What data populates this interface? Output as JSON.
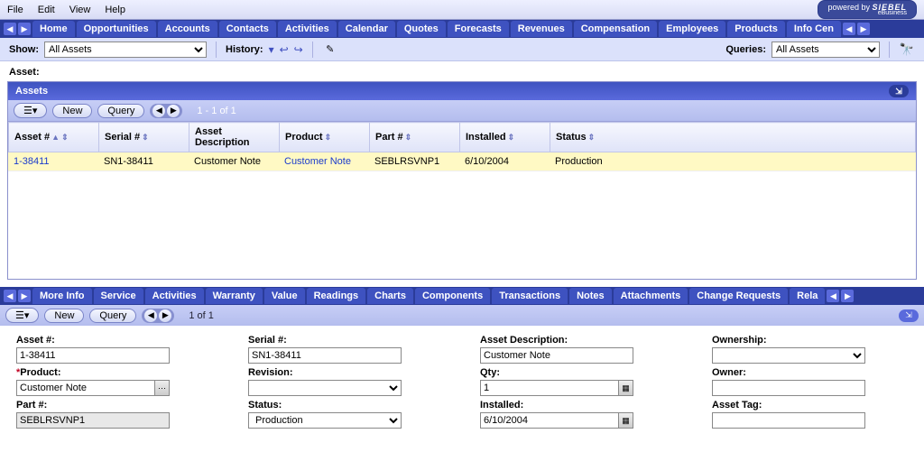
{
  "menu": {
    "file": "File",
    "edit": "Edit",
    "view": "View",
    "help": "Help"
  },
  "brand": {
    "powered": "powered by",
    "name": "SIEBEL",
    "sub": "eBusiness"
  },
  "main_tabs": [
    "Home",
    "Opportunities",
    "Accounts",
    "Contacts",
    "Activities",
    "Calendar",
    "Quotes",
    "Forecasts",
    "Revenues",
    "Compensation",
    "Employees",
    "Products",
    "Info Cen"
  ],
  "showbar": {
    "show_label": "Show:",
    "show_value": "All Assets",
    "history_label": "History:",
    "queries_label": "Queries:",
    "queries_value": "All Assets"
  },
  "asset_header": "Asset:",
  "assets_panel": {
    "title": "Assets",
    "buttons": {
      "menu": "☰▾",
      "new": "New",
      "query": "Query"
    },
    "count": "1 - 1 of 1",
    "columns": [
      "Asset #",
      "Serial #",
      "Asset Description",
      "Product",
      "Part #",
      "Installed",
      "Status"
    ],
    "rows": [
      {
        "asset_no": "1-38411",
        "serial": "SN1-38411",
        "desc": "Customer Note",
        "product": "Customer Note",
        "part": "SEBLRSVNP1",
        "installed": "6/10/2004",
        "status": "Production"
      }
    ]
  },
  "sub_tabs": [
    "More Info",
    "Service",
    "Activities",
    "Warranty",
    "Value",
    "Readings",
    "Charts",
    "Components",
    "Transactions",
    "Notes",
    "Attachments",
    "Change Requests",
    "Rela"
  ],
  "form_toolbar": {
    "menu": "☰▾",
    "new": "New",
    "query": "Query",
    "count": "1 of 1"
  },
  "form": {
    "asset_no": {
      "label": "Asset #:",
      "value": "1-38411"
    },
    "serial": {
      "label": "Serial #:",
      "value": "SN1-38411"
    },
    "desc": {
      "label": "Asset Description:",
      "value": "Customer Note"
    },
    "ownership": {
      "label": "Ownership:",
      "value": ""
    },
    "product": {
      "label": "Product:",
      "value": "Customer Note",
      "required": true
    },
    "revision": {
      "label": "Revision:",
      "value": ""
    },
    "qty": {
      "label": "Qty:",
      "value": "1"
    },
    "owner": {
      "label": "Owner:",
      "value": ""
    },
    "part": {
      "label": "Part #:",
      "value": "SEBLRSVNP1"
    },
    "status": {
      "label": "Status:",
      "value": "Production"
    },
    "installed": {
      "label": "Installed:",
      "value": "6/10/2004"
    },
    "asset_tag": {
      "label": "Asset Tag:",
      "value": ""
    }
  }
}
